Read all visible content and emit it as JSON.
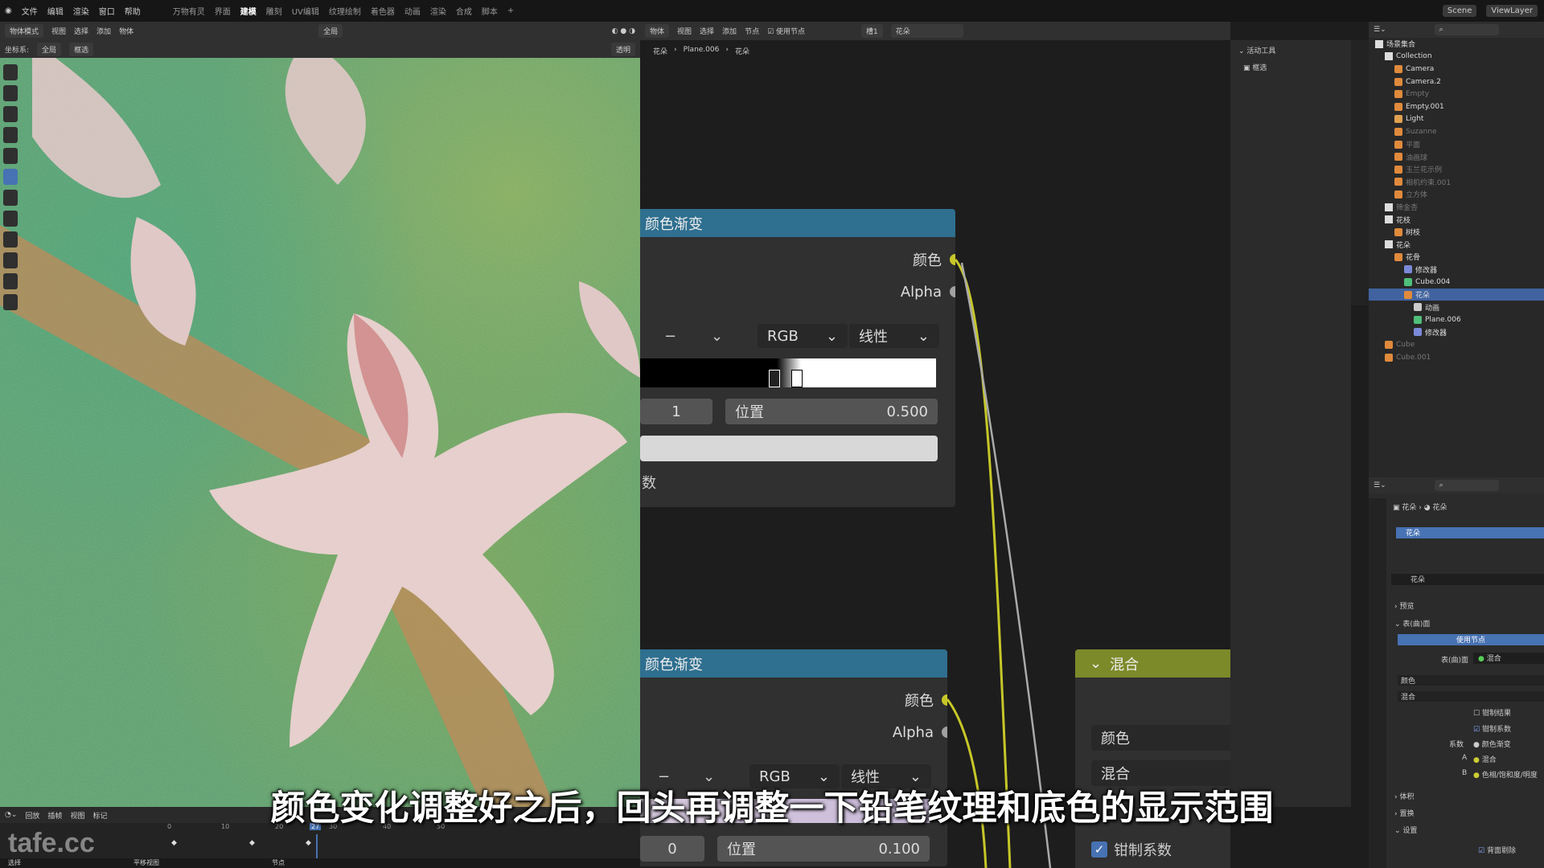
{
  "menubar": {
    "items": [
      "文件",
      "编辑",
      "渲染",
      "窗口",
      "帮助"
    ],
    "workspaces": [
      "万物有灵",
      "界面",
      "建模",
      "雕刻",
      "UV编辑",
      "纹理绘制",
      "着色器",
      "动画",
      "渲染",
      "合成",
      "脚本",
      "+"
    ],
    "active_workspace": "建模",
    "scene": "Scene",
    "view_layer": "ViewLayer"
  },
  "viewport_header": {
    "mode": "物体模式",
    "menus": [
      "视图",
      "选择",
      "添加",
      "物体"
    ],
    "transform": "全局",
    "coord_label": "坐标系:",
    "coord": "全局",
    "pivot": "框选",
    "view_mode": "透明"
  },
  "node_header": {
    "editor": "物体",
    "menus": [
      "视图",
      "选择",
      "添加",
      "节点"
    ],
    "use_nodes": "使用节点",
    "slot": "槽1",
    "material": "花朵"
  },
  "breadcrumb": [
    "花朵",
    "Plane.006",
    "花朵"
  ],
  "npanel": {
    "title": "活动工具",
    "tool": "框选"
  },
  "node1": {
    "title": "颜色渐变",
    "out_color": "颜色",
    "out_alpha": "Alpha",
    "minus": "−",
    "color_mode": "RGB",
    "interp": "线性",
    "index": "1",
    "pos_label": "位置",
    "pos_value": "0.500",
    "fac_label": "数"
  },
  "node2": {
    "title": "颜色渐变",
    "out_color": "颜色",
    "out_alpha": "Alpha",
    "minus": "−",
    "color_mode": "RGB",
    "interp": "线性",
    "index": "0",
    "pos_label": "位置",
    "pos_value": "0.100"
  },
  "mix_node": {
    "title": "混合",
    "field1": "颜色",
    "field2": "混合",
    "clamp": "钳制系数"
  },
  "outliner": {
    "root": "场景集合",
    "items": [
      {
        "name": "Collection",
        "depth": 1,
        "type": "collection",
        "dim": false,
        "sel": false
      },
      {
        "name": "Camera",
        "depth": 2,
        "type": "camera",
        "dim": false,
        "sel": false
      },
      {
        "name": "Camera.2",
        "depth": 2,
        "type": "camera",
        "dim": false,
        "sel": false
      },
      {
        "name": "Empty",
        "depth": 2,
        "type": "empty",
        "dim": true,
        "sel": false
      },
      {
        "name": "Empty.001",
        "depth": 2,
        "type": "empty",
        "dim": false,
        "sel": false
      },
      {
        "name": "Light",
        "depth": 2,
        "type": "light",
        "dim": false,
        "sel": false
      },
      {
        "name": "Suzanne",
        "depth": 2,
        "type": "mesh",
        "dim": true,
        "sel": false
      },
      {
        "name": "平面",
        "depth": 2,
        "type": "mesh",
        "dim": true,
        "sel": false
      },
      {
        "name": "油画球",
        "depth": 2,
        "type": "mesh",
        "dim": true,
        "sel": false
      },
      {
        "name": "玉兰花示例",
        "depth": 2,
        "type": "mesh",
        "dim": true,
        "sel": false
      },
      {
        "name": "相机约束.001",
        "depth": 2,
        "type": "empty",
        "dim": true,
        "sel": false
      },
      {
        "name": "立方体",
        "depth": 2,
        "type": "mesh",
        "dim": true,
        "sel": false
      },
      {
        "name": "筛金杏",
        "depth": 1,
        "type": "collection",
        "dim": true,
        "sel": false
      },
      {
        "name": "花枝",
        "depth": 1,
        "type": "collection",
        "dim": false,
        "sel": false
      },
      {
        "name": "树枝",
        "depth": 2,
        "type": "mesh",
        "dim": false,
        "sel": false
      },
      {
        "name": "花朵",
        "depth": 1,
        "type": "collection",
        "dim": false,
        "sel": false
      },
      {
        "name": "花骨",
        "depth": 2,
        "type": "mesh",
        "dim": false,
        "sel": false
      },
      {
        "name": "修改器",
        "depth": 3,
        "type": "modifier",
        "dim": false,
        "sel": false
      },
      {
        "name": "Cube.004",
        "depth": 3,
        "type": "meshdata",
        "dim": false,
        "sel": false
      },
      {
        "name": "花朵",
        "depth": 3,
        "type": "mesh",
        "dim": false,
        "sel": true
      },
      {
        "name": "动画",
        "depth": 4,
        "type": "anim",
        "dim": false,
        "sel": false
      },
      {
        "name": "Plane.006",
        "depth": 4,
        "type": "meshdata",
        "dim": false,
        "sel": false
      },
      {
        "name": "修改器",
        "depth": 4,
        "type": "modifier",
        "dim": false,
        "sel": false
      },
      {
        "name": "Cube",
        "depth": 1,
        "type": "mesh",
        "dim": true,
        "sel": false
      },
      {
        "name": "Cube.001",
        "depth": 1,
        "type": "mesh",
        "dim": true,
        "sel": false
      }
    ]
  },
  "properties": {
    "breadcrumb": [
      "花朵",
      "花朵"
    ],
    "slot": "花朵",
    "material": "花朵",
    "preview": "预览",
    "surface_section": "表(曲)面",
    "use_nodes": "使用节点",
    "surface_label": "表(曲)面",
    "surface_value": "混合",
    "color": "颜色",
    "blend": "混合",
    "clamp_result": "钳制结果",
    "clamp_factor": "钳制系数",
    "fac_label": "系数",
    "fac_value": "颜色渐变",
    "a_label": "A",
    "a_value": "混合",
    "b_label": "B",
    "b_value": "色相/饱和度/明度",
    "volume": "体积",
    "displacement": "置换",
    "settings": "设置",
    "backface": "背面剔除"
  },
  "timeline": {
    "menus": [
      "回放",
      "插帧",
      "视图",
      "标记"
    ],
    "ticks": [
      "0",
      "10",
      "20",
      "30",
      "40",
      "50"
    ],
    "current_frame": "27",
    "status": [
      "选择",
      "平移视图",
      "节点"
    ]
  },
  "subtitle": "颜色变化调整好之后，回头再调整一下铅笔纹理和底色的显示范围",
  "watermark": "tafe.cc",
  "colors": {
    "node_header_blue": "#2f6f8f",
    "mix_header": "#7d8a2a",
    "socket_yellow": "#c7c729",
    "socket_grey": "#a1a1a1",
    "selection": "#4772b3"
  }
}
